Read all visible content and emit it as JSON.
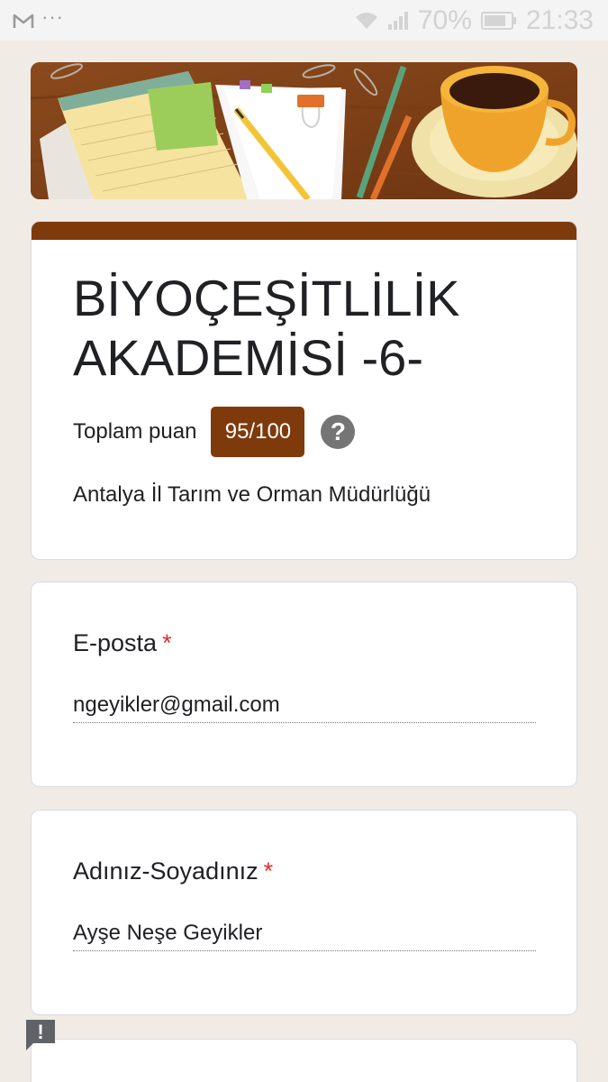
{
  "status_bar": {
    "battery_percent": "70%",
    "time": "21:33",
    "notification_icons": [
      "gmail-icon",
      "more-dots-icon"
    ],
    "indicator_icons": [
      "wifi-icon",
      "signal-icon",
      "battery-icon"
    ]
  },
  "form": {
    "title": "BİYOÇEŞİTLİLİK AKADEMİSİ -6-",
    "score_label": "Toplam puan",
    "score_value": "95/100",
    "help_symbol": "?",
    "description": "Antalya İl Tarım ve Orman Müdürlüğü",
    "accent_color": "#7f3a0c"
  },
  "questions": [
    {
      "label": "E-posta",
      "required_mark": "*",
      "answer": "ngeyikler@gmail.com"
    },
    {
      "label": "Adınız-Soyadınız",
      "required_mark": "*",
      "answer": "Ayşe Neşe Geyikler"
    }
  ],
  "feedback": {
    "symbol": "!"
  }
}
